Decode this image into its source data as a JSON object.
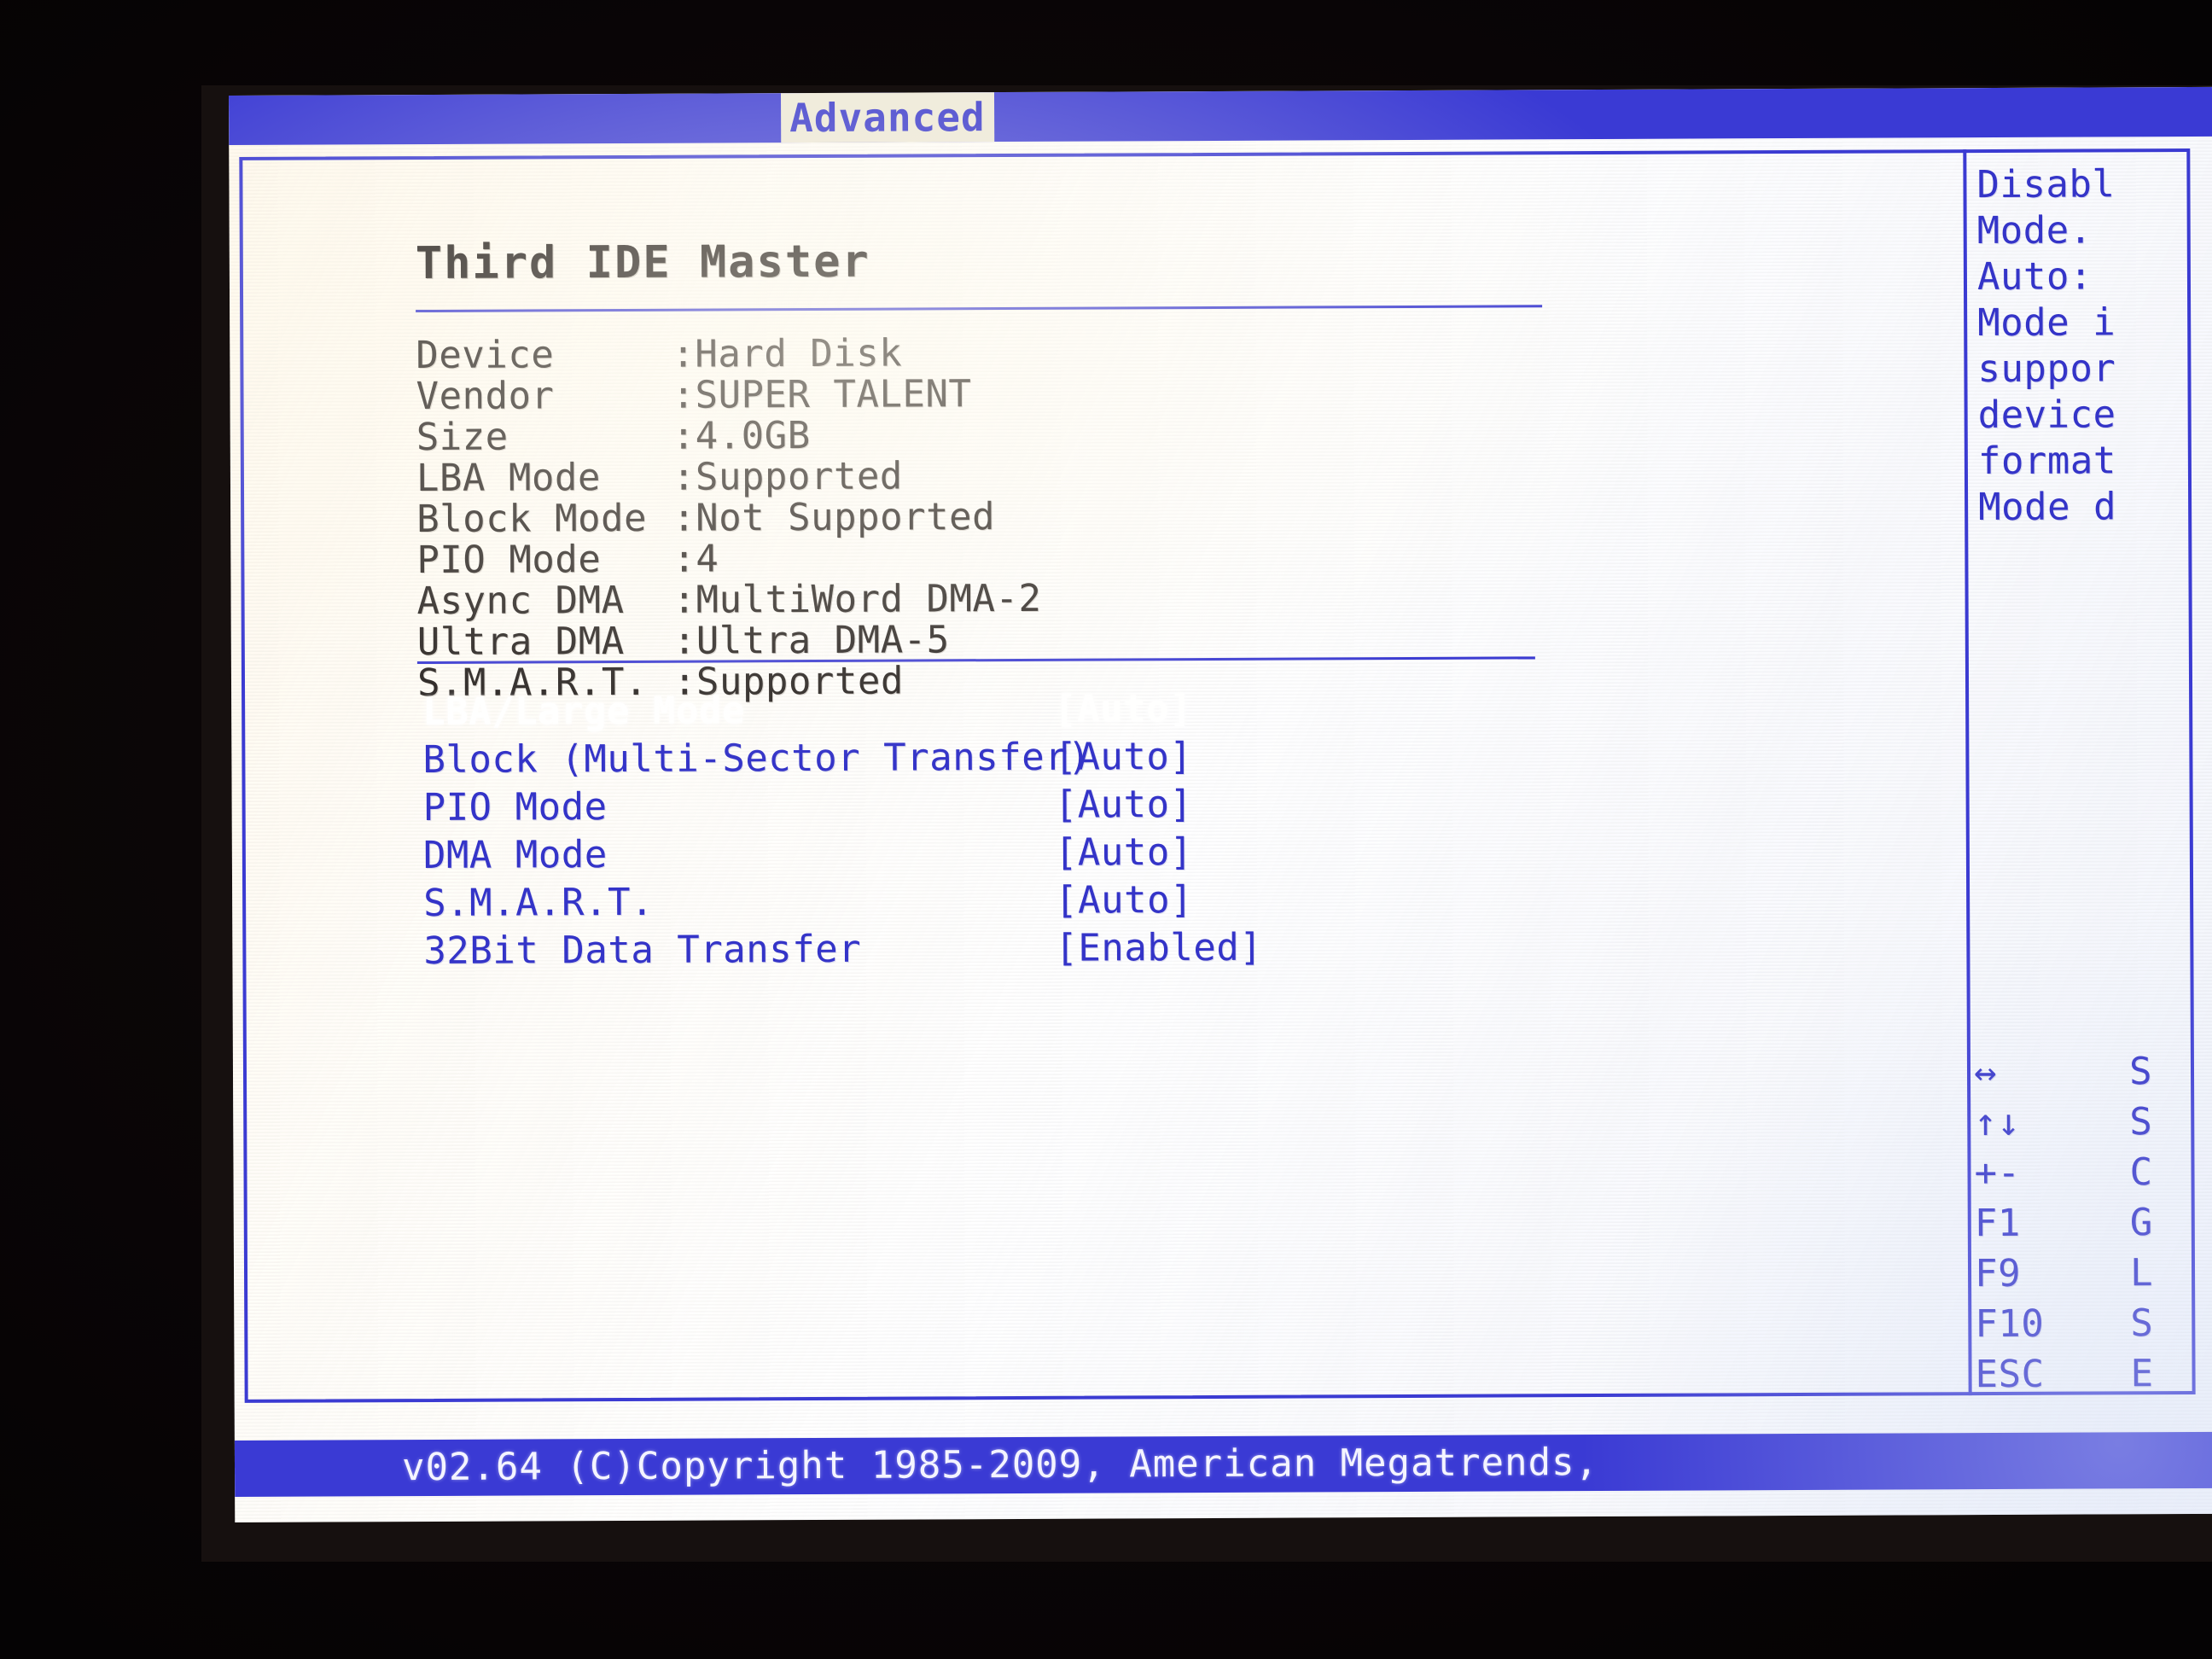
{
  "menubar": {
    "active_tab": "Advanced"
  },
  "panel": {
    "title": "Third IDE Master"
  },
  "device_info": [
    {
      "label": "Device",
      "value": ":Hard Disk"
    },
    {
      "label": "Vendor",
      "value": ":SUPER TALENT"
    },
    {
      "label": "Size",
      "value": ":4.0GB"
    },
    {
      "label": "LBA Mode",
      "value": ":Supported"
    },
    {
      "label": "Block Mode",
      "value": ":Not Supported"
    },
    {
      "label": "PIO Mode",
      "value": ":4"
    },
    {
      "label": "Async DMA",
      "value": ":MultiWord DMA-2"
    },
    {
      "label": "Ultra DMA",
      "value": ":Ultra DMA-5"
    },
    {
      "label": "S.M.A.R.T.",
      "value": ":Supported"
    }
  ],
  "settings": [
    {
      "name": "LBA/Large Mode",
      "value": "[Auto]",
      "selected": true
    },
    {
      "name": "Block (Multi-Sector Transfer)",
      "value": "[Auto]",
      "selected": false
    },
    {
      "name": "PIO Mode",
      "value": "[Auto]",
      "selected": false
    },
    {
      "name": "DMA Mode",
      "value": "[Auto]",
      "selected": false
    },
    {
      "name": "S.M.A.R.T.",
      "value": "[Auto]",
      "selected": false
    },
    {
      "name": "32Bit Data Transfer",
      "value": "[Enabled]",
      "selected": false
    }
  ],
  "help_panel": {
    "lines": [
      "Disabl",
      "Mode.",
      "Auto:",
      "Mode i",
      "suppor",
      "device",
      "format",
      "Mode d"
    ]
  },
  "key_legend": [
    {
      "key": "↔",
      "desc": "S"
    },
    {
      "key": "↑↓",
      "desc": "S"
    },
    {
      "key": "+-",
      "desc": "C"
    },
    {
      "key": "F1",
      "desc": "G"
    },
    {
      "key": "F9",
      "desc": "L"
    },
    {
      "key": "F10",
      "desc": "S"
    },
    {
      "key": "ESC",
      "desc": "E"
    }
  ],
  "footer": {
    "text": "v02.64  (C)Copyright 1985-2009, American Megatrends,"
  },
  "colors": {
    "menu_blue": "#3a3ad4",
    "border_blue": "#3b3bd2",
    "text_blue": "#3434c8",
    "info_text": "#2a2523",
    "selected_text": "#ffffff",
    "screen_bg": "#ffffff",
    "bezel": "#16100f"
  }
}
